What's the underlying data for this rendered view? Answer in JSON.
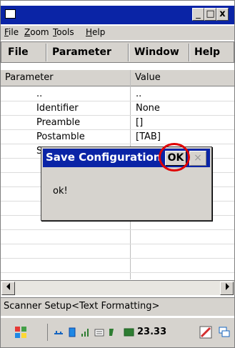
{
  "window": {
    "controls": {
      "minimize": "_",
      "maximize": "□",
      "close": "x"
    }
  },
  "os_menu": {
    "items": [
      {
        "first": "F",
        "rest": "ile"
      },
      {
        "first": "Z",
        "rest": "oom"
      },
      {
        "first": "T",
        "rest": "ools"
      },
      {
        "first": "H",
        "rest": "elp"
      }
    ]
  },
  "app_menu": {
    "items": [
      "File",
      "Parameter",
      "Window",
      "Help"
    ]
  },
  "table": {
    "headers": [
      "Parameter",
      "Value"
    ],
    "rows": [
      {
        "param": "..",
        "value": ".."
      },
      {
        "param": "Identifier",
        "value": "None"
      },
      {
        "param": "Preamble",
        "value": "[]"
      },
      {
        "param": "Postamble",
        "value": "[TAB]"
      },
      {
        "param": "S",
        "value": ""
      }
    ]
  },
  "status": {
    "text": "Scanner Setup<Text Formatting>"
  },
  "taskbar": {
    "time": "23.33"
  },
  "dialog": {
    "title": "Save Configuration",
    "ok_label": "OK",
    "close_label": "×",
    "message": "ok!"
  },
  "colors": {
    "titlebar": "#0a24a6",
    "chrome": "#d6d3ce",
    "highlight": "#e00000"
  }
}
